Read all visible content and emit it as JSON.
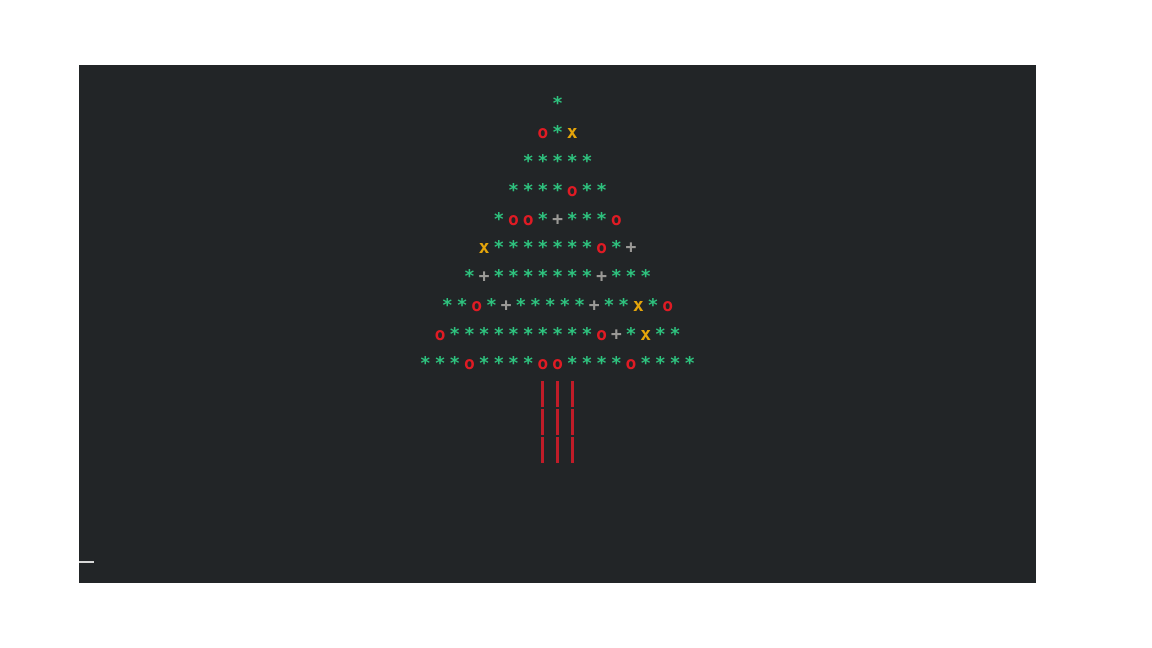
{
  "colors": {
    "background": "#222527",
    "star": "#2ec27e",
    "o": "#e01b24",
    "x": "#e5a50a",
    "plus": "#9a9996",
    "trunk": "#c01c28",
    "cursor": "#d8d8d8"
  },
  "tree": {
    "rows": [
      "*",
      "o*x",
      "*****",
      "****o**",
      "*oo*+***o",
      "x*******o*+",
      "*+*******+***",
      "**o*+*****+**x*o",
      "o**********o+*x**",
      "***o****oo****o****"
    ],
    "trunk": [
      "|||",
      "|||",
      "|||"
    ]
  }
}
